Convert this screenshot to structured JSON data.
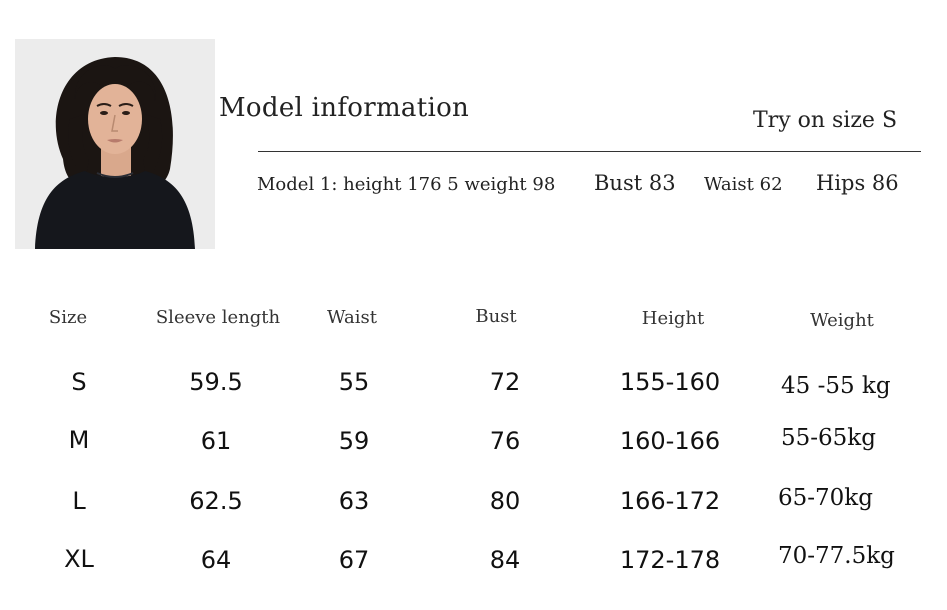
{
  "model_info": {
    "title": "Model information",
    "try_on": "Try on size S",
    "model_line": "Model 1: height 176 5 weight 98",
    "bust": "Bust 83",
    "waist": "Waist 62",
    "hips": "Hips 86"
  },
  "size_table": {
    "headers": [
      "Size",
      "Sleeve length",
      "Waist",
      "Bust",
      "Height",
      "Weight"
    ],
    "rows": [
      [
        "S",
        "59.5",
        "55",
        "72",
        "155-160",
        "45 -55 kg"
      ],
      [
        "M",
        "61",
        "59",
        "76",
        "160-166",
        "55-65kg"
      ],
      [
        "L",
        "62.5",
        "63",
        "80",
        "166-172",
        "65-70kg"
      ],
      [
        "XL",
        "64",
        "67",
        "84",
        "172-178",
        "70-77.5kg"
      ]
    ]
  }
}
